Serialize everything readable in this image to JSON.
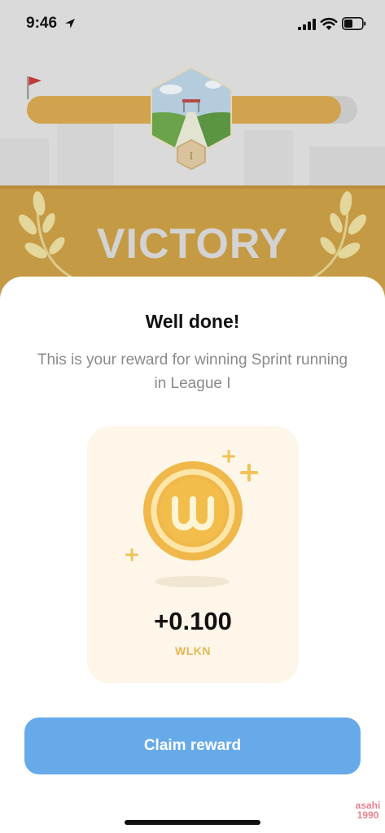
{
  "status_bar": {
    "time": "9:46",
    "icons": [
      "location-arrow-icon",
      "cellular-signal-icon",
      "wifi-icon",
      "battery-icon"
    ]
  },
  "background": {
    "league_badge_numeral": "I",
    "victory_label": "VICTORY",
    "progress_fraction": 0.95
  },
  "sheet": {
    "title": "Well done!",
    "subtitle": "This is your reward for winning Sprint running in League I",
    "reward": {
      "amount": "+0.100",
      "unit": "WLKN",
      "coin_icon": "wlkn-coin-icon"
    },
    "claim_button_label": "Claim reward"
  },
  "watermark": {
    "line1": "asahi",
    "line2": "1990"
  },
  "colors": {
    "accent_blue": "#66aaea",
    "gold": "#f0b84a",
    "card_bg": "#fdf6e9",
    "band": "#c59a44"
  }
}
